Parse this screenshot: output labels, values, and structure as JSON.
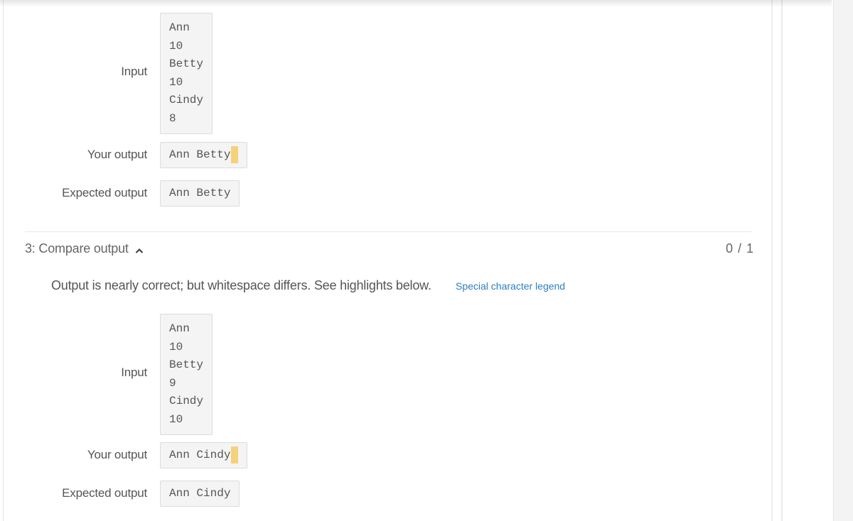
{
  "test_2": {
    "input_label": "Input",
    "input_lines": "Ann\n10\nBetty\n10\nCindy\n8",
    "your_output_label": "Your output",
    "your_output": "Ann Betty",
    "expected_output_label": "Expected output",
    "expected_output": "Ann Betty"
  },
  "test_3": {
    "title": "3: Compare output",
    "score": "0 / 1",
    "message": "Output is nearly correct; but whitespace differs. See highlights below.",
    "legend_link": "Special character legend",
    "input_label": "Input",
    "input_lines": "Ann\n10\nBetty\n9\nCindy\n10",
    "your_output_label": "Your output",
    "your_output": "Ann Cindy",
    "expected_output_label": "Expected output",
    "expected_output": "Ann Cindy"
  },
  "icons": {
    "collapse": "chevron-up-icon"
  },
  "colors": {
    "highlight": "#f5d27a",
    "link": "#2b7fc2"
  }
}
